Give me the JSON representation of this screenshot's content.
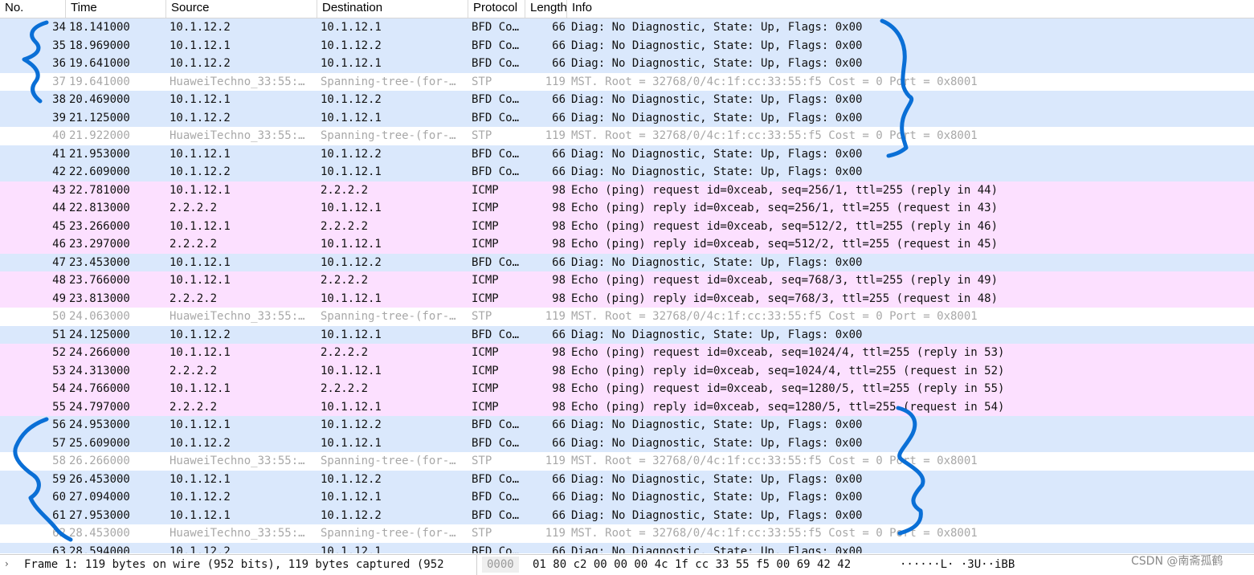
{
  "columns": [
    "No.",
    "Time",
    "Source",
    "Destination",
    "Protocol",
    "Length",
    "Info"
  ],
  "colors": {
    "BFD": "#dae8fc",
    "ICMP": "#fce0ff",
    "STP_bg": "#ffffff",
    "STP_text": "#a8a8a8",
    "annotation": "#0a6fd6"
  },
  "packets": [
    {
      "no": "34",
      "time": "18.141000",
      "src": "10.1.12.2",
      "dst": "10.1.12.1",
      "proto": "BFD Co…",
      "len": "66",
      "info": "Diag: No Diagnostic, State: Up, Flags: 0x00",
      "kind": "bfd"
    },
    {
      "no": "35",
      "time": "18.969000",
      "src": "10.1.12.1",
      "dst": "10.1.12.2",
      "proto": "BFD Co…",
      "len": "66",
      "info": "Diag: No Diagnostic, State: Up, Flags: 0x00",
      "kind": "bfd"
    },
    {
      "no": "36",
      "time": "19.641000",
      "src": "10.1.12.2",
      "dst": "10.1.12.1",
      "proto": "BFD Co…",
      "len": "66",
      "info": "Diag: No Diagnostic, State: Up, Flags: 0x00",
      "kind": "bfd"
    },
    {
      "no": "37",
      "time": "19.641000",
      "src": "HuaweiTechno_33:55:…",
      "dst": "Spanning-tree-(for-…",
      "proto": "STP",
      "len": "119",
      "info": "MST. Root = 32768/0/4c:1f:cc:33:55:f5  Cost = 0  Port = 0x8001",
      "kind": "stp"
    },
    {
      "no": "38",
      "time": "20.469000",
      "src": "10.1.12.1",
      "dst": "10.1.12.2",
      "proto": "BFD Co…",
      "len": "66",
      "info": "Diag: No Diagnostic, State: Up, Flags: 0x00",
      "kind": "bfd"
    },
    {
      "no": "39",
      "time": "21.125000",
      "src": "10.1.12.2",
      "dst": "10.1.12.1",
      "proto": "BFD Co…",
      "len": "66",
      "info": "Diag: No Diagnostic, State: Up, Flags: 0x00",
      "kind": "bfd"
    },
    {
      "no": "40",
      "time": "21.922000",
      "src": "HuaweiTechno_33:55:…",
      "dst": "Spanning-tree-(for-…",
      "proto": "STP",
      "len": "119",
      "info": "MST. Root = 32768/0/4c:1f:cc:33:55:f5  Cost = 0  Port = 0x8001",
      "kind": "stp"
    },
    {
      "no": "41",
      "time": "21.953000",
      "src": "10.1.12.1",
      "dst": "10.1.12.2",
      "proto": "BFD Co…",
      "len": "66",
      "info": "Diag: No Diagnostic, State: Up, Flags: 0x00",
      "kind": "bfd"
    },
    {
      "no": "42",
      "time": "22.609000",
      "src": "10.1.12.2",
      "dst": "10.1.12.1",
      "proto": "BFD Co…",
      "len": "66",
      "info": "Diag: No Diagnostic, State: Up, Flags: 0x00",
      "kind": "bfd"
    },
    {
      "no": "43",
      "time": "22.781000",
      "src": "10.1.12.1",
      "dst": "2.2.2.2",
      "proto": "ICMP",
      "len": "98",
      "info": "Echo (ping) request  id=0xceab, seq=256/1, ttl=255 (reply in 44)",
      "kind": "icmp"
    },
    {
      "no": "44",
      "time": "22.813000",
      "src": "2.2.2.2",
      "dst": "10.1.12.1",
      "proto": "ICMP",
      "len": "98",
      "info": "Echo (ping) reply    id=0xceab, seq=256/1, ttl=255 (request in 43)",
      "kind": "icmp"
    },
    {
      "no": "45",
      "time": "23.266000",
      "src": "10.1.12.1",
      "dst": "2.2.2.2",
      "proto": "ICMP",
      "len": "98",
      "info": "Echo (ping) request  id=0xceab, seq=512/2, ttl=255 (reply in 46)",
      "kind": "icmp"
    },
    {
      "no": "46",
      "time": "23.297000",
      "src": "2.2.2.2",
      "dst": "10.1.12.1",
      "proto": "ICMP",
      "len": "98",
      "info": "Echo (ping) reply    id=0xceab, seq=512/2, ttl=255 (request in 45)",
      "kind": "icmp"
    },
    {
      "no": "47",
      "time": "23.453000",
      "src": "10.1.12.1",
      "dst": "10.1.12.2",
      "proto": "BFD Co…",
      "len": "66",
      "info": "Diag: No Diagnostic, State: Up, Flags: 0x00",
      "kind": "bfd"
    },
    {
      "no": "48",
      "time": "23.766000",
      "src": "10.1.12.1",
      "dst": "2.2.2.2",
      "proto": "ICMP",
      "len": "98",
      "info": "Echo (ping) request  id=0xceab, seq=768/3, ttl=255 (reply in 49)",
      "kind": "icmp"
    },
    {
      "no": "49",
      "time": "23.813000",
      "src": "2.2.2.2",
      "dst": "10.1.12.1",
      "proto": "ICMP",
      "len": "98",
      "info": "Echo (ping) reply    id=0xceab, seq=768/3, ttl=255 (request in 48)",
      "kind": "icmp"
    },
    {
      "no": "50",
      "time": "24.063000",
      "src": "HuaweiTechno_33:55:…",
      "dst": "Spanning-tree-(for-…",
      "proto": "STP",
      "len": "119",
      "info": "MST. Root = 32768/0/4c:1f:cc:33:55:f5  Cost = 0  Port = 0x8001",
      "kind": "stp"
    },
    {
      "no": "51",
      "time": "24.125000",
      "src": "10.1.12.2",
      "dst": "10.1.12.1",
      "proto": "BFD Co…",
      "len": "66",
      "info": "Diag: No Diagnostic, State: Up, Flags: 0x00",
      "kind": "bfd"
    },
    {
      "no": "52",
      "time": "24.266000",
      "src": "10.1.12.1",
      "dst": "2.2.2.2",
      "proto": "ICMP",
      "len": "98",
      "info": "Echo (ping) request  id=0xceab, seq=1024/4, ttl=255 (reply in 53)",
      "kind": "icmp"
    },
    {
      "no": "53",
      "time": "24.313000",
      "src": "2.2.2.2",
      "dst": "10.1.12.1",
      "proto": "ICMP",
      "len": "98",
      "info": "Echo (ping) reply    id=0xceab, seq=1024/4, ttl=255 (request in 52)",
      "kind": "icmp"
    },
    {
      "no": "54",
      "time": "24.766000",
      "src": "10.1.12.1",
      "dst": "2.2.2.2",
      "proto": "ICMP",
      "len": "98",
      "info": "Echo (ping) request  id=0xceab, seq=1280/5, ttl=255 (reply in 55)",
      "kind": "icmp"
    },
    {
      "no": "55",
      "time": "24.797000",
      "src": "2.2.2.2",
      "dst": "10.1.12.1",
      "proto": "ICMP",
      "len": "98",
      "info": "Echo (ping) reply    id=0xceab, seq=1280/5, ttl=255 (request in 54)",
      "kind": "icmp"
    },
    {
      "no": "56",
      "time": "24.953000",
      "src": "10.1.12.1",
      "dst": "10.1.12.2",
      "proto": "BFD Co…",
      "len": "66",
      "info": "Diag: No Diagnostic, State: Up, Flags: 0x00",
      "kind": "bfd"
    },
    {
      "no": "57",
      "time": "25.609000",
      "src": "10.1.12.2",
      "dst": "10.1.12.1",
      "proto": "BFD Co…",
      "len": "66",
      "info": "Diag: No Diagnostic, State: Up, Flags: 0x00",
      "kind": "bfd"
    },
    {
      "no": "58",
      "time": "26.266000",
      "src": "HuaweiTechno_33:55:…",
      "dst": "Spanning-tree-(for-…",
      "proto": "STP",
      "len": "119",
      "info": "MST. Root = 32768/0/4c:1f:cc:33:55:f5  Cost = 0  Port = 0x8001",
      "kind": "stp"
    },
    {
      "no": "59",
      "time": "26.453000",
      "src": "10.1.12.1",
      "dst": "10.1.12.2",
      "proto": "BFD Co…",
      "len": "66",
      "info": "Diag: No Diagnostic, State: Up, Flags: 0x00",
      "kind": "bfd"
    },
    {
      "no": "60",
      "time": "27.094000",
      "src": "10.1.12.2",
      "dst": "10.1.12.1",
      "proto": "BFD Co…",
      "len": "66",
      "info": "Diag: No Diagnostic, State: Up, Flags: 0x00",
      "kind": "bfd"
    },
    {
      "no": "61",
      "time": "27.953000",
      "src": "10.1.12.1",
      "dst": "10.1.12.2",
      "proto": "BFD Co…",
      "len": "66",
      "info": "Diag: No Diagnostic, State: Up, Flags: 0x00",
      "kind": "bfd"
    },
    {
      "no": "62",
      "time": "28.453000",
      "src": "HuaweiTechno_33:55:…",
      "dst": "Spanning-tree-(for-…",
      "proto": "STP",
      "len": "119",
      "info": "MST. Root = 32768/0/4c:1f:cc:33:55:f5  Cost = 0  Port = 0x8001",
      "kind": "stp"
    },
    {
      "no": "63",
      "time": "28.594000",
      "src": "10.1.12.2",
      "dst": "10.1.12.1",
      "proto": "BFD Co…",
      "len": "66",
      "info": "Diag: No Diagnostic, State: Up, Flags: 0x00",
      "kind": "bfd"
    }
  ],
  "status": {
    "expand_icon": "chevron-right-icon",
    "expand_glyph": "›",
    "frame_text": "Frame 1: 119 bytes on wire (952 bits), 119 bytes captured (952",
    "hex_offset": "0000",
    "hex_bytes": "01 80 c2 00 00 00 4c 1f  cc 33 55 f5 00 69 42 42",
    "ascii": "······L· ·3U··iBB"
  },
  "watermark": "CSDN @南斋孤鹤"
}
